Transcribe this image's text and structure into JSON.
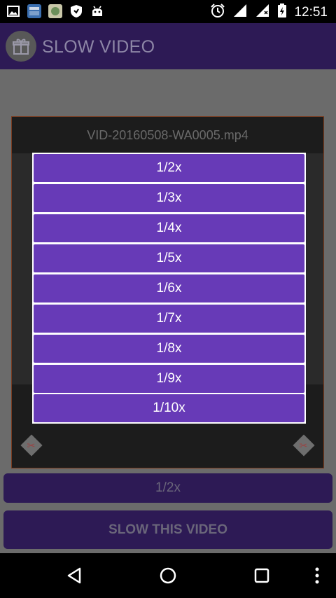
{
  "status_bar": {
    "time": "12:51",
    "left_icons": [
      "image-icon",
      "app-thumb-icon",
      "app-thumb-icon-2",
      "shield-icon",
      "android-icon"
    ],
    "right_icons": [
      "alarm-icon",
      "signal-icon",
      "signal-icon-2",
      "battery-icon"
    ]
  },
  "app_bar": {
    "title": "SLOW VIDEO",
    "left_icon": "gift-icon"
  },
  "player": {
    "filename": "VID-20160508-WA0005.mp4"
  },
  "speed_selector": {
    "value": "1/2x"
  },
  "action": {
    "slow_label": "SLOW THIS VIDEO"
  },
  "popup": {
    "options": [
      "1/2x",
      "1/3x",
      "1/4x",
      "1/5x",
      "1/6x",
      "1/7x",
      "1/8x",
      "1/9x",
      "1/10x"
    ]
  },
  "colors": {
    "accent": "#673ab7",
    "app_bar": "#2d1a55"
  }
}
